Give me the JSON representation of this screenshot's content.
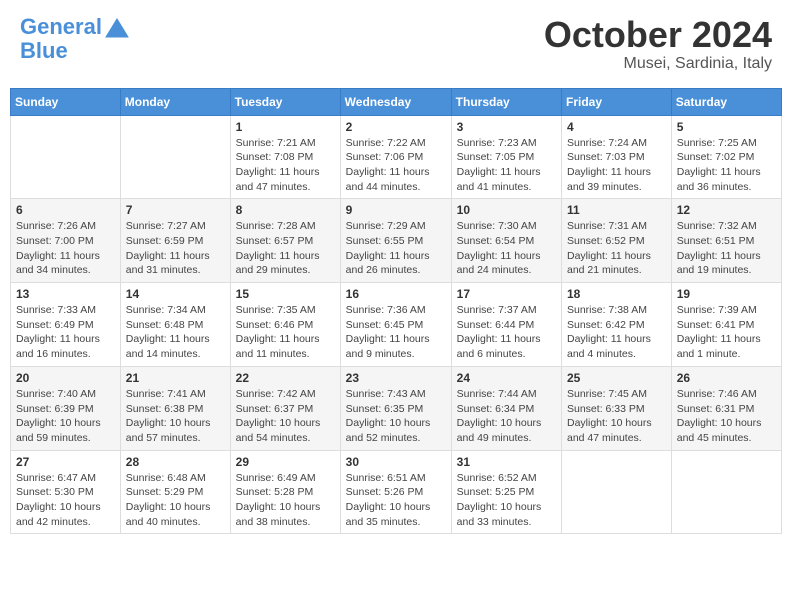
{
  "header": {
    "logo_line1": "General",
    "logo_line2": "Blue",
    "month": "October 2024",
    "location": "Musei, Sardinia, Italy"
  },
  "weekdays": [
    "Sunday",
    "Monday",
    "Tuesday",
    "Wednesday",
    "Thursday",
    "Friday",
    "Saturday"
  ],
  "weeks": [
    [
      {
        "day": "",
        "info": ""
      },
      {
        "day": "",
        "info": ""
      },
      {
        "day": "1",
        "info": "Sunrise: 7:21 AM\nSunset: 7:08 PM\nDaylight: 11 hours and 47 minutes."
      },
      {
        "day": "2",
        "info": "Sunrise: 7:22 AM\nSunset: 7:06 PM\nDaylight: 11 hours and 44 minutes."
      },
      {
        "day": "3",
        "info": "Sunrise: 7:23 AM\nSunset: 7:05 PM\nDaylight: 11 hours and 41 minutes."
      },
      {
        "day": "4",
        "info": "Sunrise: 7:24 AM\nSunset: 7:03 PM\nDaylight: 11 hours and 39 minutes."
      },
      {
        "day": "5",
        "info": "Sunrise: 7:25 AM\nSunset: 7:02 PM\nDaylight: 11 hours and 36 minutes."
      }
    ],
    [
      {
        "day": "6",
        "info": "Sunrise: 7:26 AM\nSunset: 7:00 PM\nDaylight: 11 hours and 34 minutes."
      },
      {
        "day": "7",
        "info": "Sunrise: 7:27 AM\nSunset: 6:59 PM\nDaylight: 11 hours and 31 minutes."
      },
      {
        "day": "8",
        "info": "Sunrise: 7:28 AM\nSunset: 6:57 PM\nDaylight: 11 hours and 29 minutes."
      },
      {
        "day": "9",
        "info": "Sunrise: 7:29 AM\nSunset: 6:55 PM\nDaylight: 11 hours and 26 minutes."
      },
      {
        "day": "10",
        "info": "Sunrise: 7:30 AM\nSunset: 6:54 PM\nDaylight: 11 hours and 24 minutes."
      },
      {
        "day": "11",
        "info": "Sunrise: 7:31 AM\nSunset: 6:52 PM\nDaylight: 11 hours and 21 minutes."
      },
      {
        "day": "12",
        "info": "Sunrise: 7:32 AM\nSunset: 6:51 PM\nDaylight: 11 hours and 19 minutes."
      }
    ],
    [
      {
        "day": "13",
        "info": "Sunrise: 7:33 AM\nSunset: 6:49 PM\nDaylight: 11 hours and 16 minutes."
      },
      {
        "day": "14",
        "info": "Sunrise: 7:34 AM\nSunset: 6:48 PM\nDaylight: 11 hours and 14 minutes."
      },
      {
        "day": "15",
        "info": "Sunrise: 7:35 AM\nSunset: 6:46 PM\nDaylight: 11 hours and 11 minutes."
      },
      {
        "day": "16",
        "info": "Sunrise: 7:36 AM\nSunset: 6:45 PM\nDaylight: 11 hours and 9 minutes."
      },
      {
        "day": "17",
        "info": "Sunrise: 7:37 AM\nSunset: 6:44 PM\nDaylight: 11 hours and 6 minutes."
      },
      {
        "day": "18",
        "info": "Sunrise: 7:38 AM\nSunset: 6:42 PM\nDaylight: 11 hours and 4 minutes."
      },
      {
        "day": "19",
        "info": "Sunrise: 7:39 AM\nSunset: 6:41 PM\nDaylight: 11 hours and 1 minute."
      }
    ],
    [
      {
        "day": "20",
        "info": "Sunrise: 7:40 AM\nSunset: 6:39 PM\nDaylight: 10 hours and 59 minutes."
      },
      {
        "day": "21",
        "info": "Sunrise: 7:41 AM\nSunset: 6:38 PM\nDaylight: 10 hours and 57 minutes."
      },
      {
        "day": "22",
        "info": "Sunrise: 7:42 AM\nSunset: 6:37 PM\nDaylight: 10 hours and 54 minutes."
      },
      {
        "day": "23",
        "info": "Sunrise: 7:43 AM\nSunset: 6:35 PM\nDaylight: 10 hours and 52 minutes."
      },
      {
        "day": "24",
        "info": "Sunrise: 7:44 AM\nSunset: 6:34 PM\nDaylight: 10 hours and 49 minutes."
      },
      {
        "day": "25",
        "info": "Sunrise: 7:45 AM\nSunset: 6:33 PM\nDaylight: 10 hours and 47 minutes."
      },
      {
        "day": "26",
        "info": "Sunrise: 7:46 AM\nSunset: 6:31 PM\nDaylight: 10 hours and 45 minutes."
      }
    ],
    [
      {
        "day": "27",
        "info": "Sunrise: 6:47 AM\nSunset: 5:30 PM\nDaylight: 10 hours and 42 minutes."
      },
      {
        "day": "28",
        "info": "Sunrise: 6:48 AM\nSunset: 5:29 PM\nDaylight: 10 hours and 40 minutes."
      },
      {
        "day": "29",
        "info": "Sunrise: 6:49 AM\nSunset: 5:28 PM\nDaylight: 10 hours and 38 minutes."
      },
      {
        "day": "30",
        "info": "Sunrise: 6:51 AM\nSunset: 5:26 PM\nDaylight: 10 hours and 35 minutes."
      },
      {
        "day": "31",
        "info": "Sunrise: 6:52 AM\nSunset: 5:25 PM\nDaylight: 10 hours and 33 minutes."
      },
      {
        "day": "",
        "info": ""
      },
      {
        "day": "",
        "info": ""
      }
    ]
  ]
}
